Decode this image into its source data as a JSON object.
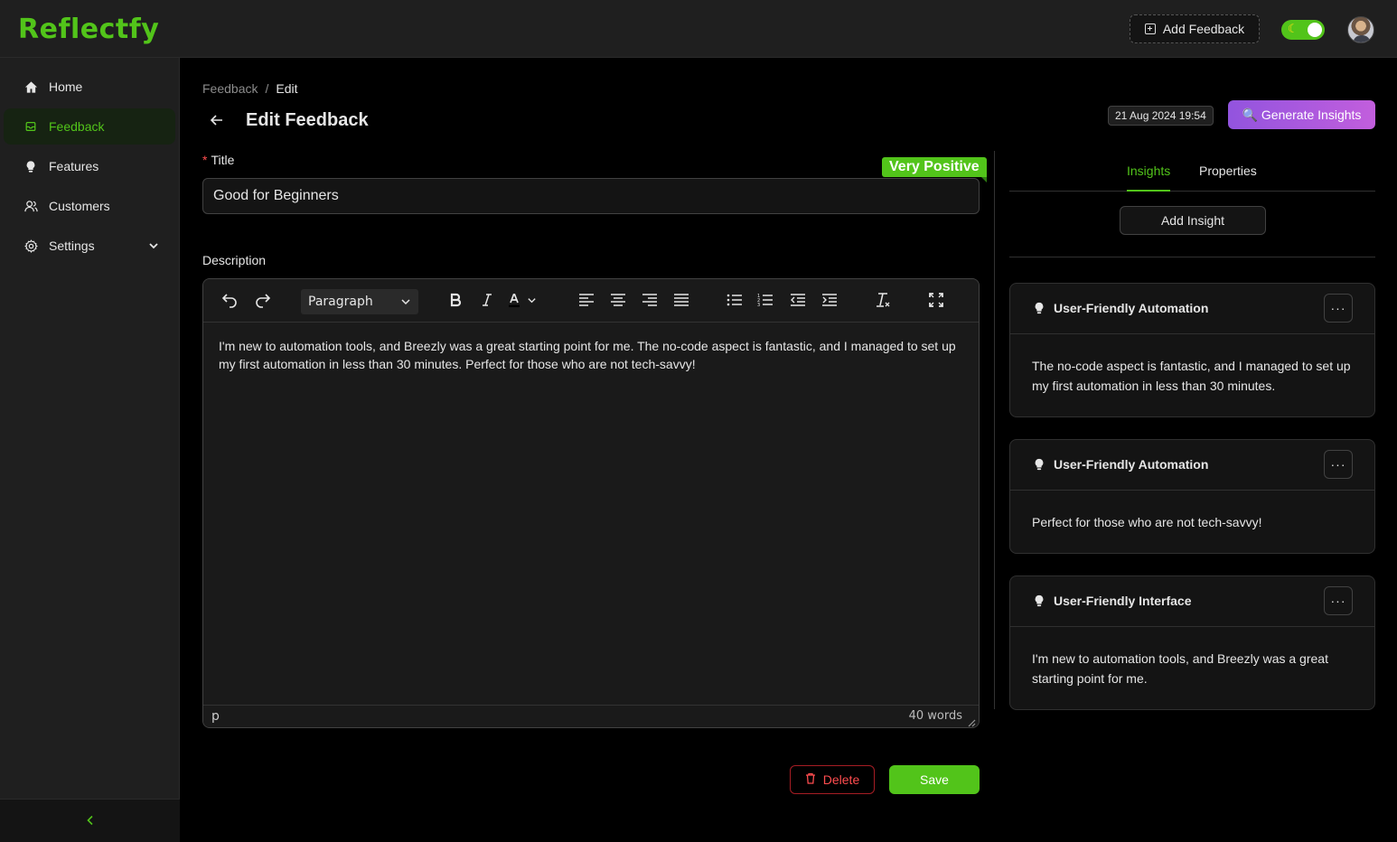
{
  "app": {
    "brand": "Reflectfy",
    "add_feedback_label": "Add Feedback",
    "theme_icon": "moon"
  },
  "sidebar": {
    "items": [
      {
        "label": "Home",
        "icon": "home-icon"
      },
      {
        "label": "Feedback",
        "icon": "inbox-icon",
        "active": true
      },
      {
        "label": "Features",
        "icon": "bulb-icon"
      },
      {
        "label": "Customers",
        "icon": "users-icon"
      },
      {
        "label": "Settings",
        "icon": "gear-icon"
      }
    ]
  },
  "breadcrumb": {
    "parent": "Feedback",
    "separator": "/",
    "current": "Edit"
  },
  "page": {
    "title": "Edit Feedback",
    "date": "21 Aug 2024 19:54",
    "generate_label": "🔍 Generate Insights"
  },
  "form": {
    "title_label": "Title",
    "title_value": "Good for Beginners",
    "sentiment": "Very Positive",
    "description_label": "Description",
    "block_format": "Paragraph",
    "description_text": "I'm new to automation tools, and Breezly was a great starting point for me. The no-code aspect is fantastic, and I managed to set up my first automation in less than 30 minutes. Perfect for those who are not tech-savvy!",
    "status_path": "p",
    "word_count": "40 words",
    "delete_label": "Delete",
    "save_label": "Save"
  },
  "insights_panel": {
    "tabs": [
      {
        "label": "Insights",
        "active": true
      },
      {
        "label": "Properties"
      }
    ],
    "add_insight_label": "Add Insight",
    "cards": [
      {
        "title": "User-Friendly Automation",
        "text": "The no-code aspect is fantastic, and I managed to set up my first automation in less than 30 minutes."
      },
      {
        "title": "User-Friendly Automation",
        "text": "Perfect for those who are not tech-savvy!"
      },
      {
        "title": "User-Friendly Interface",
        "text": "I'm new to automation tools, and Breezly was a great starting point for me."
      }
    ],
    "more_label": "···"
  },
  "colors": {
    "accent": "#52c41a",
    "danger": "#ff4d4f",
    "generate_gradient_start": "#9254de",
    "generate_gradient_end": "#c25edd"
  }
}
